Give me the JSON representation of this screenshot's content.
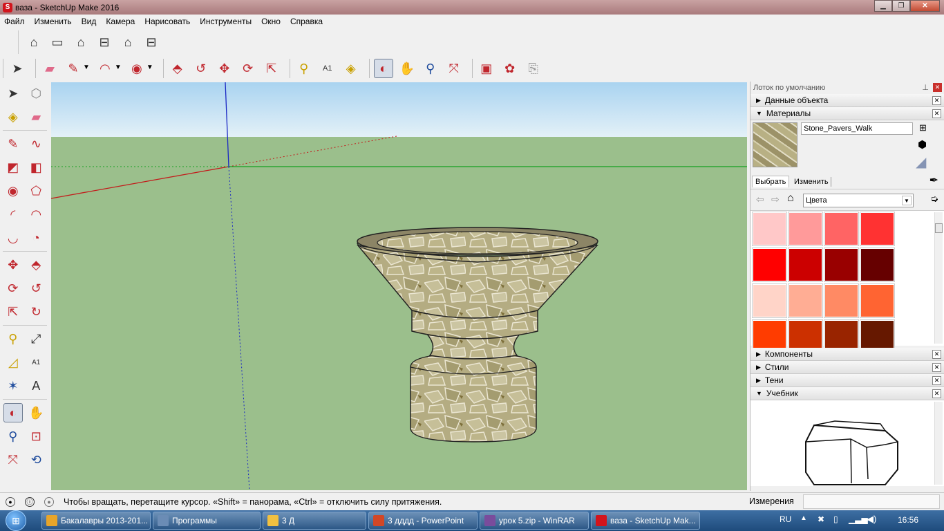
{
  "window": {
    "title": "ваза - SketchUp Make 2016",
    "minimize": "▁",
    "maximize": "❐",
    "close": "✕"
  },
  "menu": [
    "Файл",
    "Изменить",
    "Вид",
    "Камера",
    "Нарисовать",
    "Инструменты",
    "Окно",
    "Справка"
  ],
  "panel": {
    "tray_title": "Лоток по умолчанию",
    "entity_info": "Данные объекта",
    "materials": "Материалы",
    "material_name": "Stone_Pavers_Walk",
    "tab_select": "Выбрать",
    "tab_edit": "Изменить",
    "library": "Цвета",
    "components": "Компоненты",
    "styles": "Стили",
    "shadows": "Тени",
    "instructor": "Учебник",
    "swatch_colors": [
      "#ffc8c8",
      "#ff9a9a",
      "#ff6464",
      "#ff3232",
      "#ff0000",
      "#cc0000",
      "#990000",
      "#660000",
      "#ffd4c8",
      "#ffad94",
      "#ff8a64",
      "#ff6432",
      "#ff3c00",
      "#cc3000",
      "#992400",
      "#661800"
    ]
  },
  "status": {
    "hint": "Чтобы вращать, перетащите курсор. «Shift» = панорама, «Ctrl» = отключить силу притяжения.",
    "measurements_label": "Измерения",
    "measurements_value": ""
  },
  "taskbar": {
    "items": [
      {
        "label": "Бакалавры 2013-201...",
        "color": "#e8a52a"
      },
      {
        "label": "Программы",
        "color": "#6b8cb5"
      },
      {
        "label": "3 Д",
        "color": "#f0c040"
      },
      {
        "label": "3 дддд - PowerPoint",
        "color": "#d24726"
      },
      {
        "label": "урок 5.zip - WinRAR",
        "color": "#7a4c9c"
      },
      {
        "label": "ваза - SketchUp Mak...",
        "color": "#d2141c"
      }
    ],
    "lang": "RU",
    "clock": "16:56"
  },
  "colors": {
    "sky": "#b8dcf4",
    "ground": "#9bbf8c",
    "accent": "#3a6ea5"
  }
}
